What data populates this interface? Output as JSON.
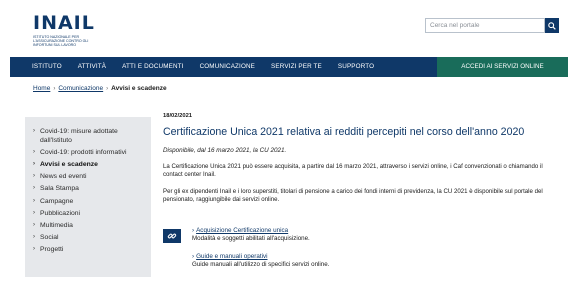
{
  "header": {
    "logo": "INAIL",
    "logo_subtitle": "ISTITUTO NAZIONALE PER L'ASSICURAZIONE CONTRO GLI INFORTUNI SUL LAVORO",
    "search_placeholder": "Cerca nel portale",
    "search_icon": "search-icon"
  },
  "nav": {
    "items": [
      "ISTITUTO",
      "ATTIVITÀ",
      "ATTI E DOCUMENTI",
      "COMUNICAZIONE",
      "SERVIZI PER TE",
      "SUPPORTO"
    ],
    "cta": "ACCEDI AI SERVIZI ONLINE",
    "cta_color": "#196c5a",
    "primary_color": "#0f3868"
  },
  "breadcrumb": {
    "home": "Home",
    "section": "Comunicazione",
    "current": "Avvisi e scadenze"
  },
  "sidebar": {
    "items": [
      {
        "label": "Covid-19: misure adottate dall'Istituto",
        "active": false
      },
      {
        "label": "Covid-19: prodotti informativi",
        "active": false
      },
      {
        "label": "Avvisi e scadenze",
        "active": true
      },
      {
        "label": "News ed eventi",
        "active": false
      },
      {
        "label": "Sala Stampa",
        "active": false
      },
      {
        "label": "Campagne",
        "active": false
      },
      {
        "label": "Pubblicazioni",
        "active": false
      },
      {
        "label": "Multimedia",
        "active": false
      },
      {
        "label": "Social",
        "active": false
      },
      {
        "label": "Progetti",
        "active": false
      }
    ]
  },
  "article": {
    "date": "18/02/2021",
    "title": "Certificazione Unica 2021 relativa ai redditi percepiti nel corso dell'anno 2020",
    "subtitle": "Disponibile, dal 16 marzo 2021, la CU 2021.",
    "paragraphs": [
      "La Certificazione Unica 2021 può essere acquisita, a partire dal 16 marzo 2021, attraverso i servizi online, i Caf convenzionati o chiamando il contact center Inail.",
      "Per gli ex dipendenti Inail e i loro superstiti, titolari di pensione a carico dei fondi interni di previdenza, la CU 2021 è disponibile sul portale del pensionato, raggiungibile dai servizi online."
    ],
    "links": [
      {
        "title": "Acquisizione Certificazione unica",
        "description": "Modalità e soggetti abilitati all'acquisizione."
      },
      {
        "title": "Guide e manuali operativi",
        "description": "Guide manuali all'utilizzo di specifici servizi online."
      }
    ],
    "link_icon": "link-icon"
  }
}
